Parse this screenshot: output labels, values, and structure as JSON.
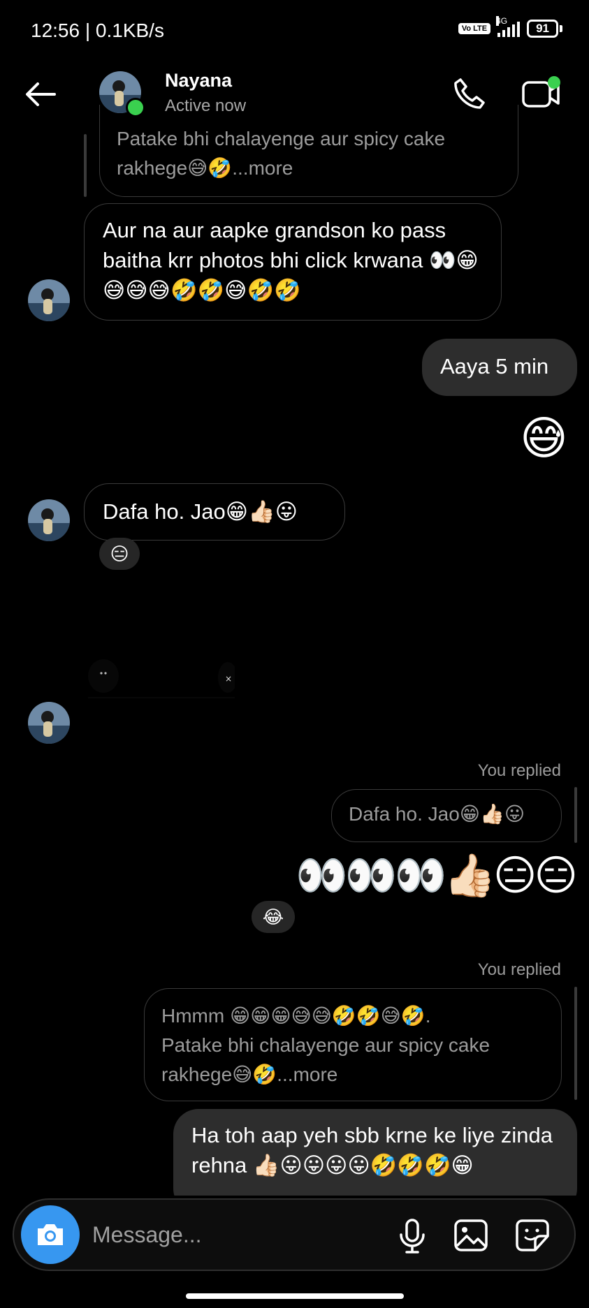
{
  "status_bar": {
    "time": "12:56 | 0.1KB/s",
    "volte": "Vo LTE",
    "network": "4G",
    "battery": "91"
  },
  "header": {
    "name": "Nayana",
    "status": "Active now",
    "icons": [
      "arrow-left-icon",
      "phone-icon",
      "video-camera-icon"
    ],
    "presence_color": "#3ad04f"
  },
  "messages": {
    "m1_quote_line1": "Patake bhi chalayenge aur spicy cake",
    "m1_quote_line2": "rakhege😅🤣",
    "m1_quote_more": "...more",
    "m2": "Aur na aur aapke grandson ko pass baitha krr photos bhi click krwana 👀😁😅😅😅🤣🤣😅🤣🤣",
    "m3": "Aaya 5 min",
    "m4": "😅",
    "m5": "Dafa ho. Jao😁👍🏻😛",
    "m5_reaction": "😑",
    "m6_label": "You replied",
    "m6_quote": "Dafa ho. Jao😁👍🏻😛",
    "m6": "👀👀👀👍🏻😑😑",
    "m6_reaction": "😂",
    "m7_label": "You replied",
    "m7_quote_line1": "Hmmm 😁😁😁😅😅🤣🤣😅🤣.",
    "m7_quote_line2": "Patake bhi chalayenge aur spicy cake",
    "m7_quote_line3": "rakhege😅🤣",
    "m7_quote_more": "...more",
    "m8": "Ha toh aap yeh sbb krne ke liye zinda rehna 👍🏻😛😛😛😛🤣🤣🤣😁"
  },
  "composer": {
    "placeholder": "Message...",
    "icons": [
      "camera-icon",
      "microphone-icon",
      "gallery-icon",
      "sticker-icon"
    ],
    "camera_color": "#3797f0"
  }
}
